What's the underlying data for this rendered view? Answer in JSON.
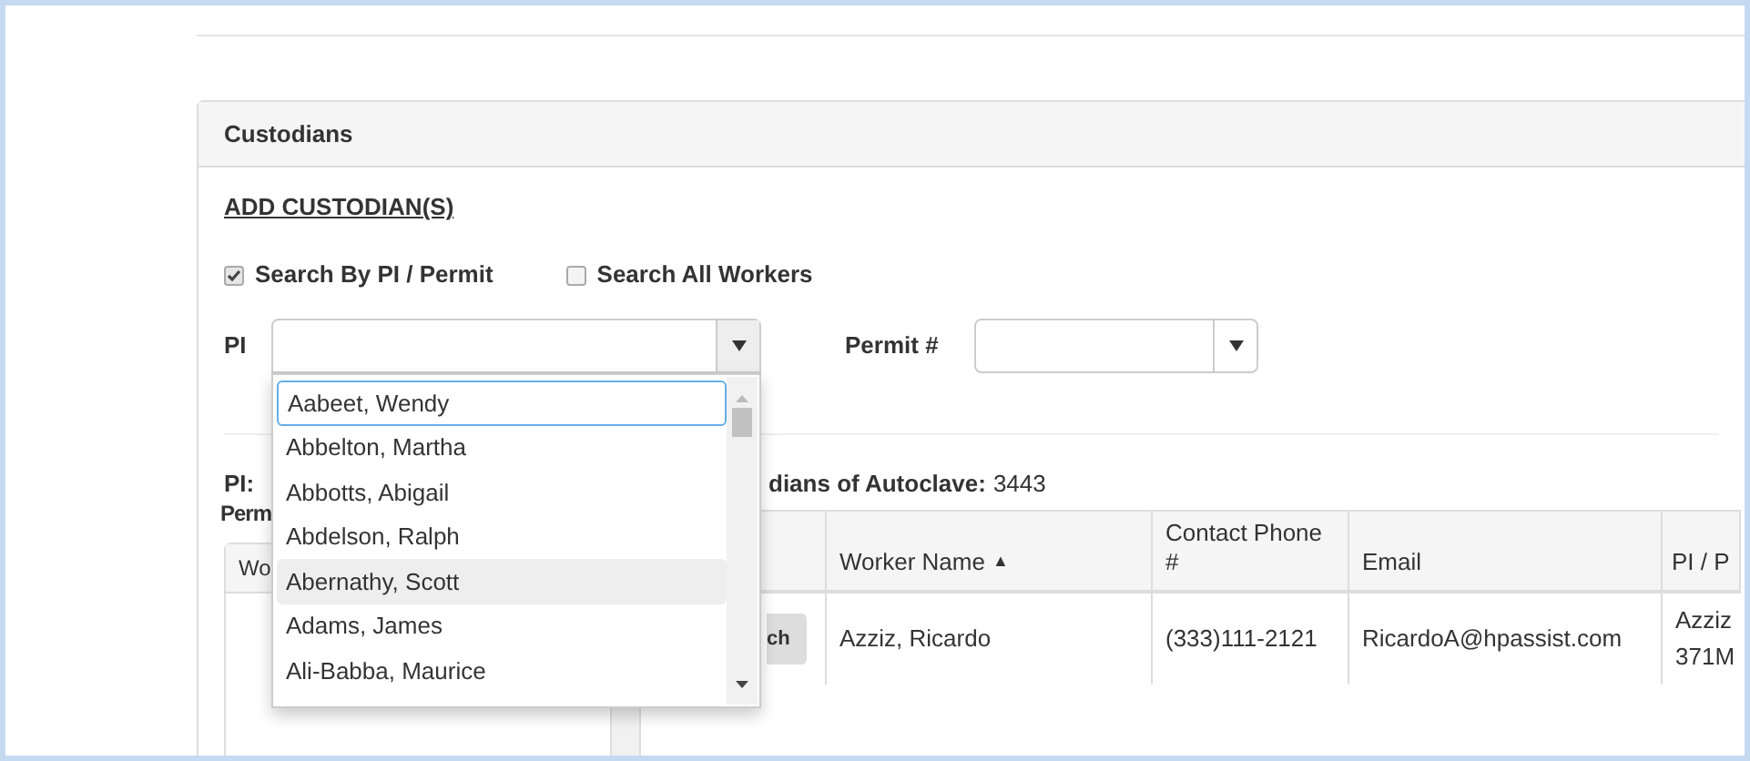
{
  "panel": {
    "title": "Custodians",
    "add_link": "ADD CUSTODIAN(S)",
    "search_modes": [
      {
        "label": "Search By PI / Permit",
        "checked": true
      },
      {
        "label": "Search All Workers",
        "checked": false
      }
    ],
    "pi_select": {
      "label": "PI",
      "expanded": true
    },
    "permit_select": {
      "label": "Permit #"
    },
    "pi_options": [
      {
        "label": "Aabeet, Wendy",
        "selected": true,
        "hovered": false
      },
      {
        "label": "Abbelton, Martha",
        "selected": false,
        "hovered": false
      },
      {
        "label": "Abbotts, Abigail",
        "selected": false,
        "hovered": false
      },
      {
        "label": "Abdelson, Ralph",
        "selected": false,
        "hovered": false
      },
      {
        "label": "Abernathy, Scott",
        "selected": false,
        "hovered": true
      },
      {
        "label": "Adams, James",
        "selected": false,
        "hovered": false
      },
      {
        "label": "Ali-Babba, Maurice",
        "selected": false,
        "hovered": false
      }
    ],
    "left_section": {
      "pi_label": "PI:",
      "permit_label": "Perm",
      "list_header": "Wo"
    },
    "custodians": {
      "title": "dians of Autoclave:",
      "value": "3443",
      "columns": [
        {
          "label": "Worker Name",
          "sort_mark": "▲"
        },
        {
          "label": "Contact Phone #"
        },
        {
          "label": "Email"
        },
        {
          "label": "PI / P"
        }
      ],
      "rows": [
        {
          "action": "ch",
          "cells": [
            "Azziz, Ricardo",
            "(333)111-2121",
            "RicardoA@hpassist.com"
          ],
          "pi_lines": [
            "Azziz",
            "371M"
          ]
        }
      ]
    }
  }
}
